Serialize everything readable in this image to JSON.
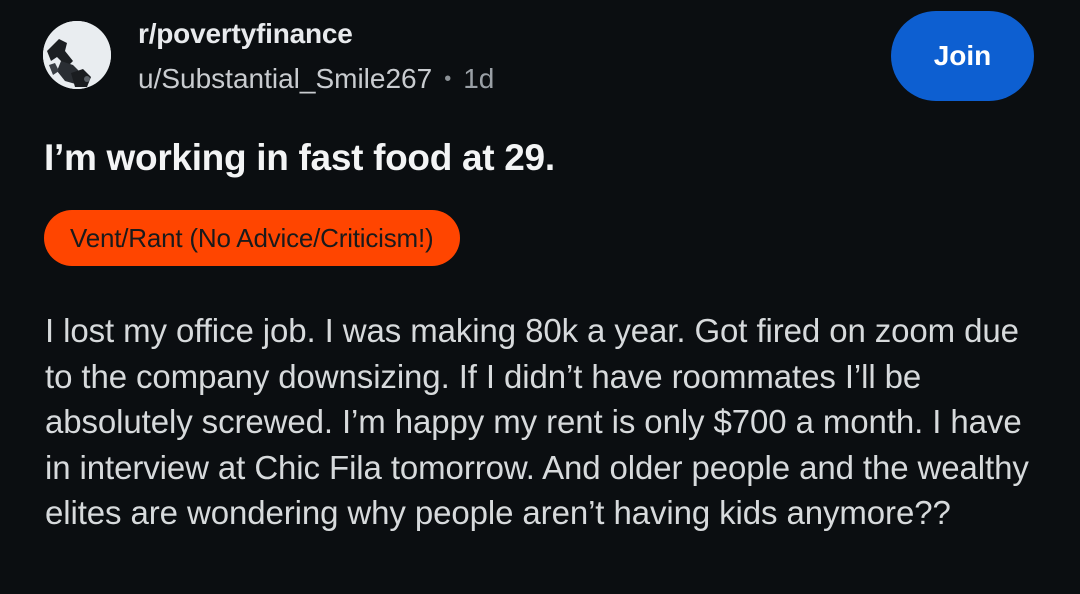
{
  "post": {
    "subreddit": "r/povertyfinance",
    "author": "u/Substantial_Smile267",
    "separator": "•",
    "age": "1d",
    "join_label": "Join",
    "title": "I’m working in fast food at 29.",
    "flair": "Vent/Rant (No Advice/Criticism!)",
    "flair_color": "#ff4500",
    "body": "I lost my office job. I was making 80k a year. Got fired on zoom due to the company downsizing. If I didn’t have roommates I’ll be absolutely screwed. I’m happy my rent is only $700 a month. I have in interview at Chic Fila tomorrow. And older people and the wealthy elites are wondering why people aren’t having kids anymore??"
  },
  "colors": {
    "background": "#0b0e11",
    "join_button": "#0d5fd1"
  },
  "icons": {
    "avatar": "subreddit-avatar-icon"
  }
}
